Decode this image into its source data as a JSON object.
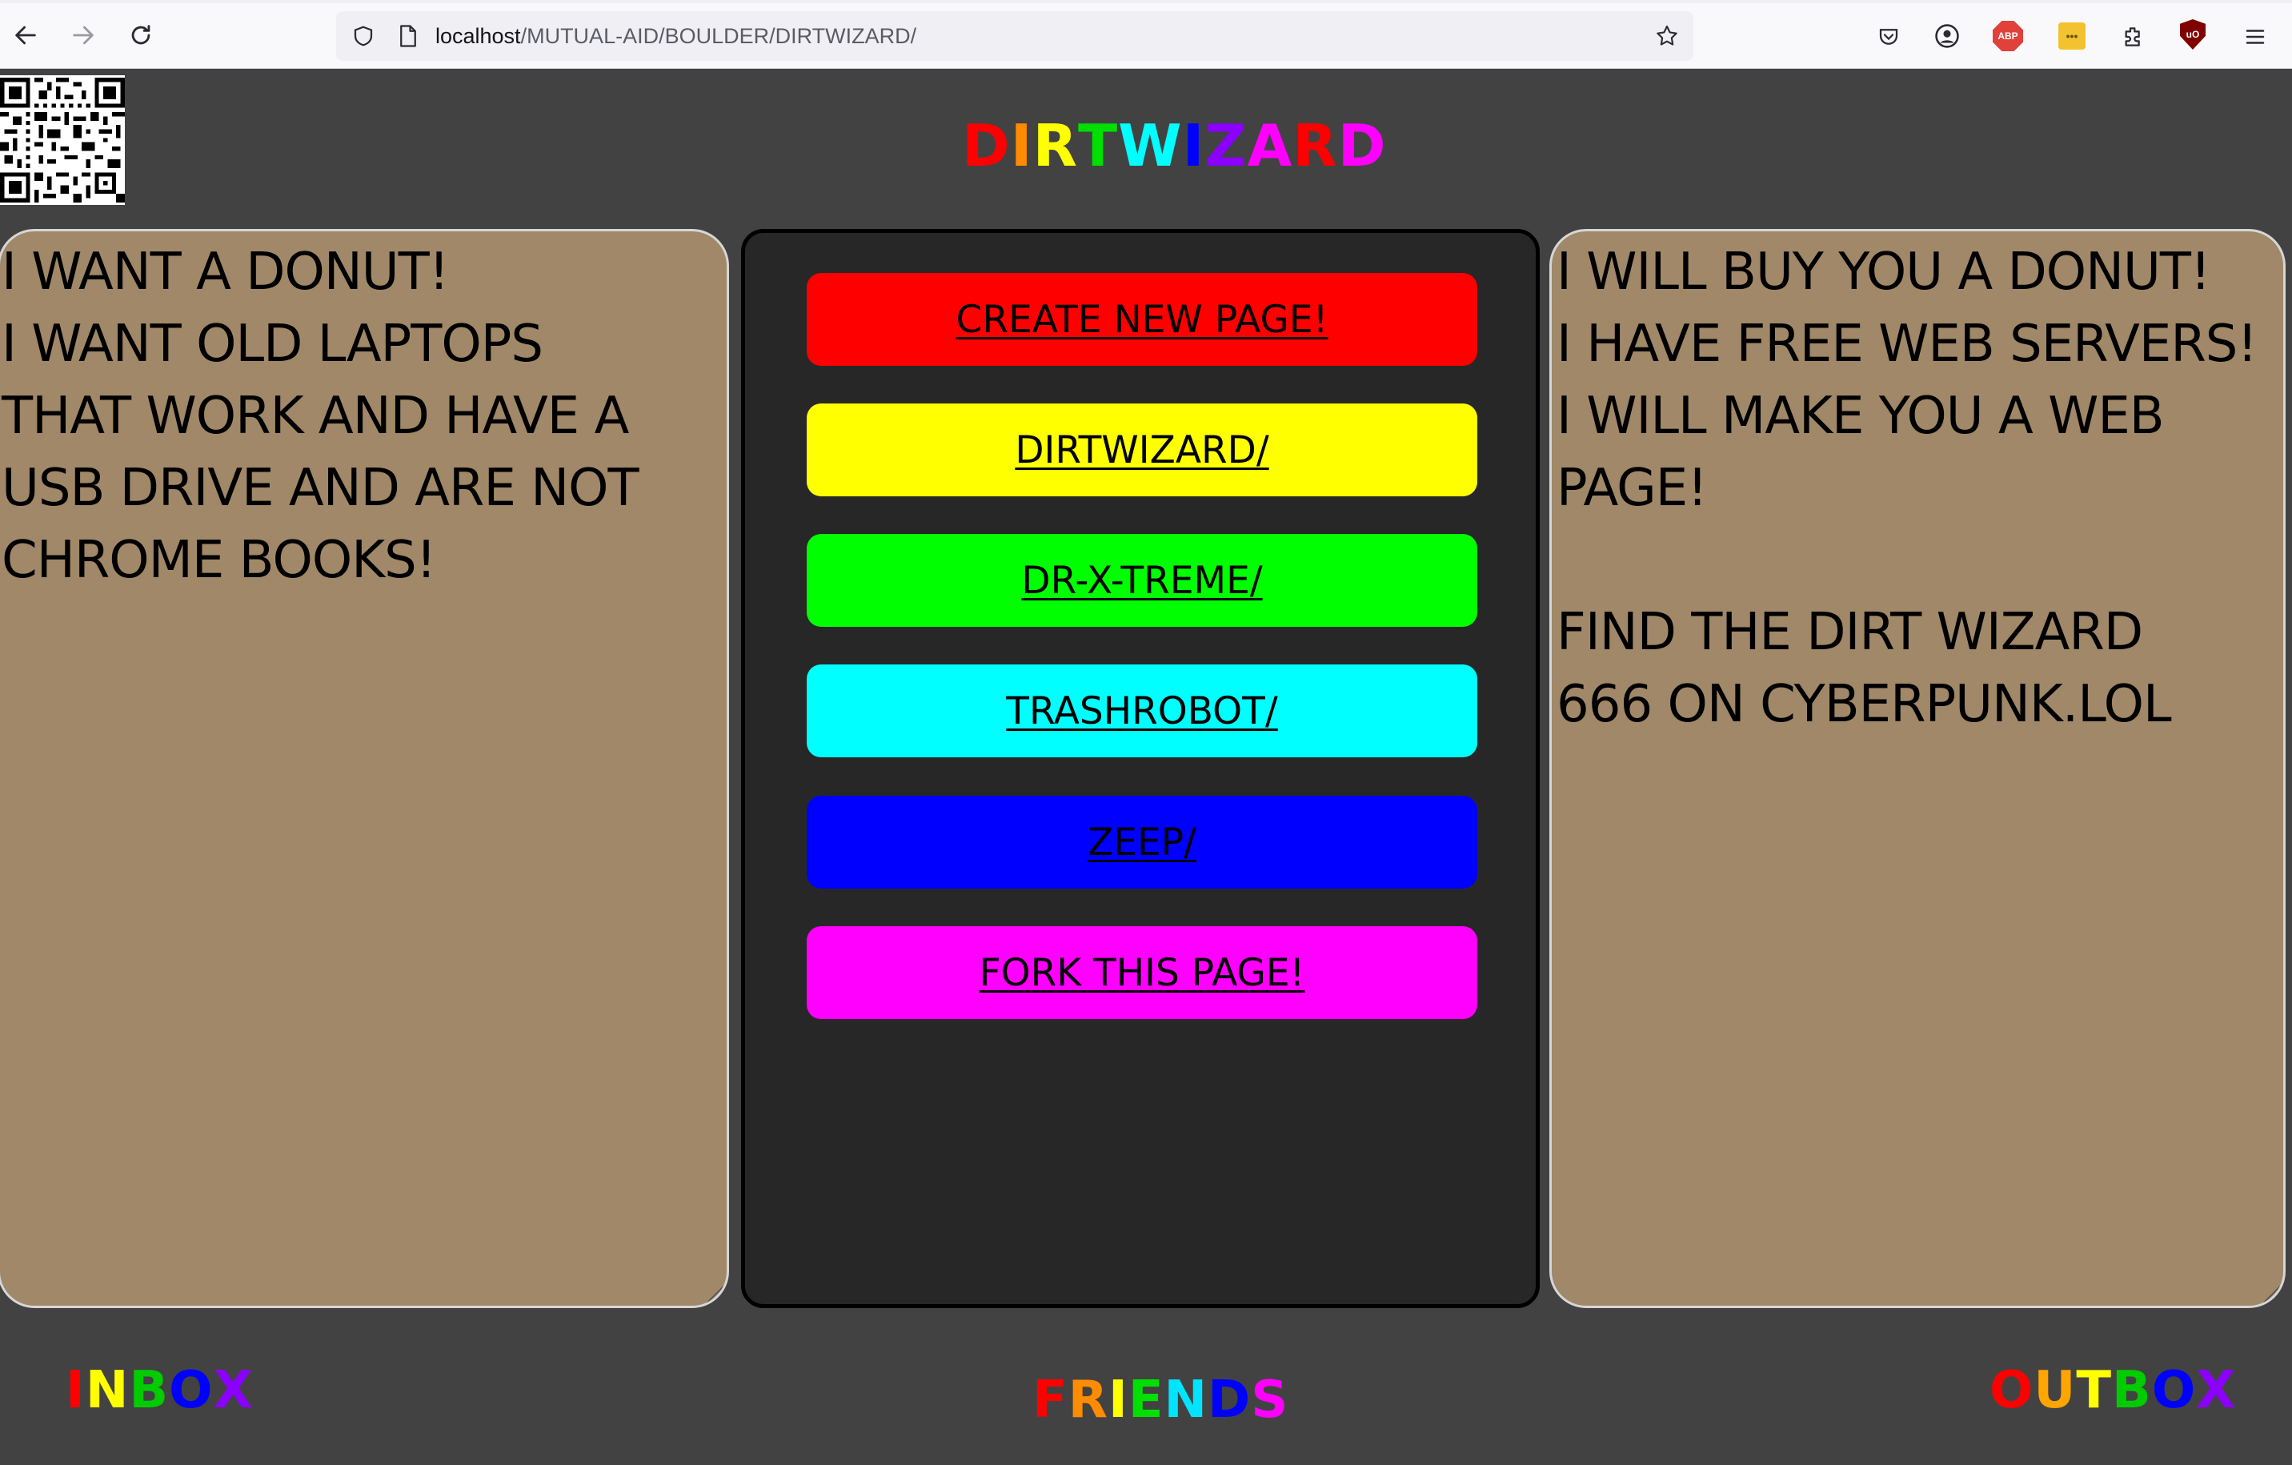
{
  "browser": {
    "url_host": "localhost",
    "url_path": "/MUTUAL-AID/BOULDER/DIRTWIZARD/",
    "icons": [
      "back-icon",
      "forward-icon",
      "reload-icon",
      "shield-icon",
      "page-icon",
      "bookmark-star-icon",
      "pocket-icon",
      "account-icon",
      "adblock-plus-icon",
      "extension-icon",
      "extensions-puzzle-icon",
      "ublock-origin-icon",
      "menu-icon"
    ],
    "abp_label": "ABP",
    "ublock_label": "uO",
    "yellow_ext_label": "•••"
  },
  "header": {
    "title_letters": [
      "D",
      "I",
      "R",
      "T",
      "W",
      "I",
      "Z",
      "A",
      "R",
      "D"
    ],
    "title_colors": [
      "#ff0000",
      "#ff8c00",
      "#ffff00",
      "#00e000",
      "#00ffff",
      "#0000ff",
      "#8b00ff",
      "#ff00ff",
      "#ff0000",
      "#ff00ff"
    ]
  },
  "left_panel": {
    "text": "I WANT A DONUT!\nI WANT OLD LAPTOPS\nTHAT WORK AND HAVE A\nUSB DRIVE AND ARE NOT\nCHROME BOOKS!"
  },
  "right_panel": {
    "text": "I WILL BUY YOU A DONUT!\nI HAVE FREE WEB SERVERS!\nI WILL MAKE YOU A WEB\nPAGE!\n\nFIND THE DIRT WIZARD\n666 ON CYBERPUNK.LOL"
  },
  "menu": {
    "buttons": [
      {
        "label": "CREATE NEW PAGE!",
        "color": "#ff0000"
      },
      {
        "label": "DIRTWIZARD/",
        "color": "#ffff00"
      },
      {
        "label": "DR-X-TREME/",
        "color": "#00ff00"
      },
      {
        "label": "TRASHROBOT/",
        "color": "#00ffff"
      },
      {
        "label": "ZEEP/",
        "color": "#0000ff"
      },
      {
        "label": "FORK THIS PAGE!",
        "color": "#ff00ff"
      }
    ]
  },
  "footer": {
    "inbox_letters": [
      "I",
      "N",
      "B",
      "O",
      "X"
    ],
    "inbox_colors": [
      "#ff0000",
      "#ffff00",
      "#00cc00",
      "#0000ff",
      "#8b00ff"
    ],
    "friends_letters": [
      "F",
      "R",
      "I",
      "E",
      "N",
      "D",
      "S"
    ],
    "friends_colors": [
      "#ff0000",
      "#ff8c00",
      "#ffff00",
      "#00e000",
      "#00e5ff",
      "#0000ff",
      "#ff00ff"
    ],
    "outbox_letters": [
      "O",
      "U",
      "T",
      "B",
      "O",
      "X"
    ],
    "outbox_colors": [
      "#ff0000",
      "#ffa500",
      "#ffff00",
      "#00cc00",
      "#0000ff",
      "#8b00ff"
    ]
  }
}
